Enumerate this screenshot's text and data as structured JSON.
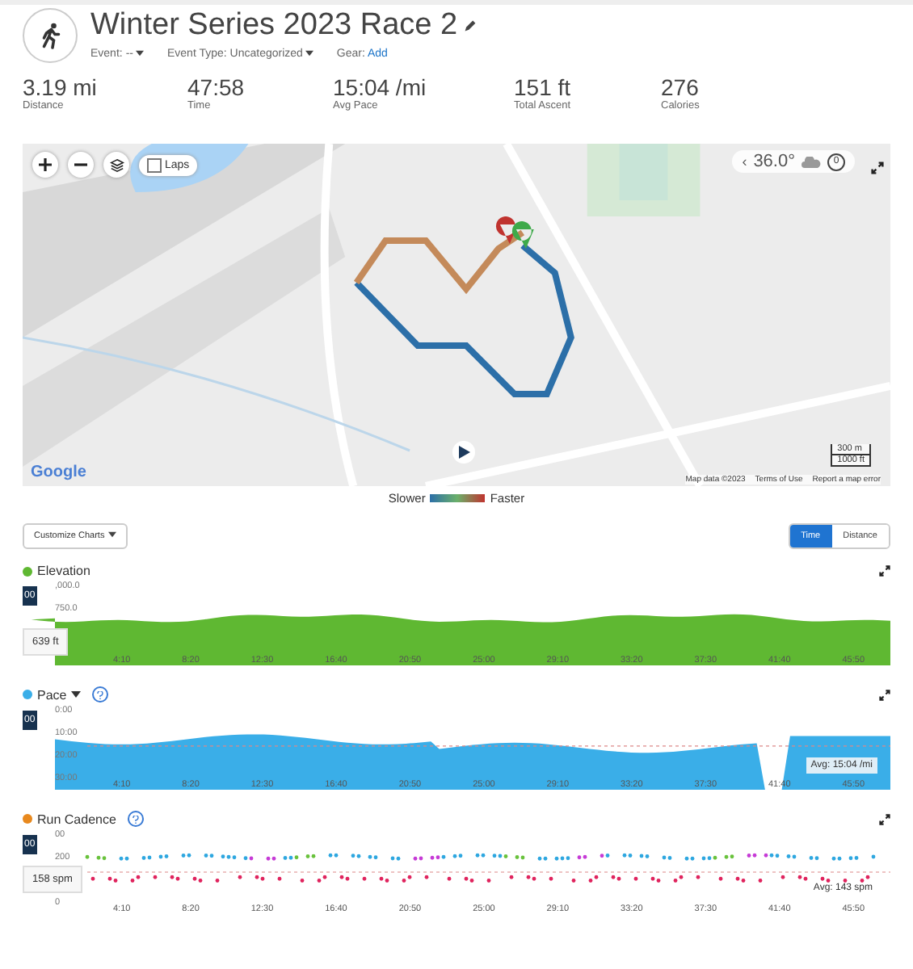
{
  "activity": {
    "title": "Winter Series 2023 Race 2",
    "event_label": "Event:",
    "event_value": "--",
    "event_type_label": "Event Type:",
    "event_type_value": "Uncategorized",
    "gear_label": "Gear:",
    "gear_link": "Add"
  },
  "stats": [
    {
      "value": "3.19 mi",
      "label": "Distance"
    },
    {
      "value": "47:58",
      "label": "Time"
    },
    {
      "value": "15:04 /mi",
      "label": "Avg Pace"
    },
    {
      "value": "151 ft",
      "label": "Total Ascent"
    },
    {
      "value": "276",
      "label": "Calories"
    }
  ],
  "map": {
    "laps": {
      "label": "Laps",
      "checked": false
    },
    "weather": {
      "back": "‹",
      "temperature": "36.0°",
      "wind": "0"
    },
    "logo": "Google",
    "scale": [
      "300 m",
      "1000 ft"
    ],
    "attribution": [
      "Map data ©2023",
      "Terms of Use",
      "Report a map error"
    ]
  },
  "legend": {
    "slower": "Slower",
    "faster": "Faster"
  },
  "toolbar": {
    "customize": "Customize Charts",
    "axis": [
      {
        "label": "Time",
        "selected": true
      },
      {
        "label": "Distance",
        "selected": false
      }
    ]
  },
  "charts": [
    {
      "kind": "area",
      "title": "Elevation",
      "color": "#5fb832",
      "dropdown": false,
      "help": false,
      "badge": "00",
      "y_labels": [
        ",000.0",
        "750.0"
      ],
      "x_labels": [
        "4:10",
        "8:20",
        "12:30",
        "16:40",
        "20:50",
        "25:00",
        "29:10",
        "33:20",
        "37:30",
        "41:40",
        "45:50"
      ],
      "tooltip": "639 ft"
    },
    {
      "kind": "pace",
      "title": "Pace",
      "color": "#3aaee8",
      "dropdown": true,
      "help": true,
      "badge": "00",
      "y_labels": [
        "0:00",
        "10:00",
        "20:00",
        "30:00"
      ],
      "x_labels": [
        "4:10",
        "8:20",
        "12:30",
        "16:40",
        "20:50",
        "25:00",
        "29:10",
        "33:20",
        "37:30",
        "41:40",
        "45:50"
      ],
      "average": "Avg: 15:04 /mi"
    },
    {
      "kind": "scatter",
      "title": "Run Cadence",
      "color": "#e8891e",
      "dropdown": false,
      "help": true,
      "badge": "00",
      "y_labels": [
        "00",
        "200",
        "0"
      ],
      "x_labels": [
        "4:10",
        "8:20",
        "12:30",
        "16:40",
        "20:50",
        "25:00",
        "29:10",
        "33:20",
        "37:30",
        "41:40",
        "45:50"
      ],
      "tooltip": "158 spm",
      "average": "Avg: 143 spm"
    }
  ]
}
